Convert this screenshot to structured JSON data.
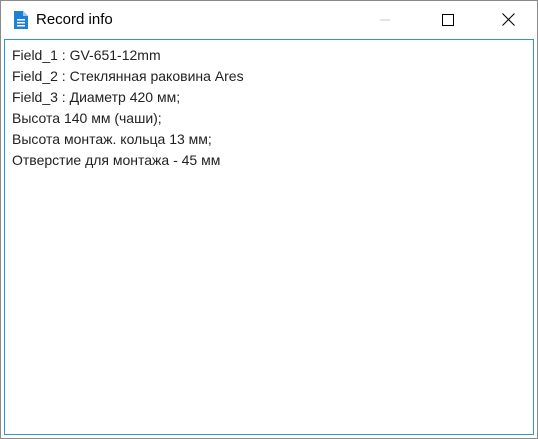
{
  "window": {
    "title": "Record info",
    "icon": "document-icon"
  },
  "titlebar_buttons": {
    "minimize_icon": "minimize-icon",
    "maximize_icon": "maximize-icon",
    "close_icon": "close-icon"
  },
  "colors": {
    "content_border": "#2c97c9",
    "icon_blue": "#1e7fd6"
  },
  "record": {
    "lines": [
      "Field_1 : GV-651-12mm",
      "Field_2 : Стеклянная раковина Ares",
      "Field_3 : Диаметр 420 мм;",
      "Высота 140 мм (чаши);",
      "Высота монтаж. кольца 13 мм;",
      "Отверстие для монтажа - 45 мм"
    ]
  }
}
